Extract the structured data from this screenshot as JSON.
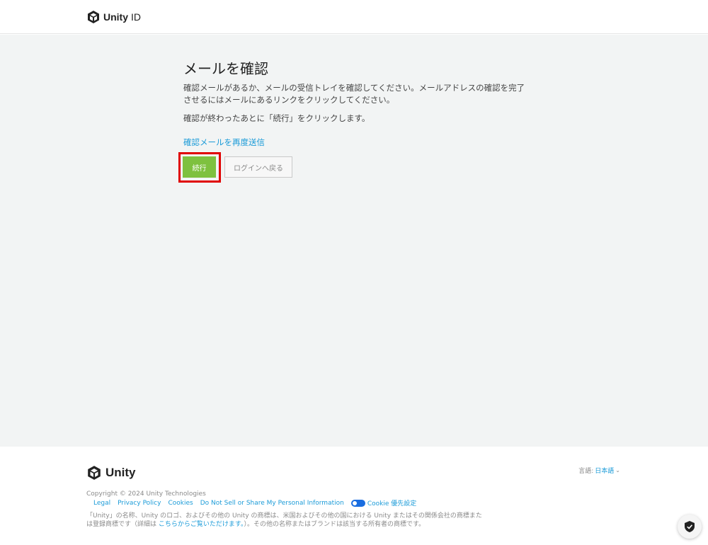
{
  "header": {
    "brand_bold": "Unity",
    "brand_light": "ID"
  },
  "main": {
    "title": "メールを確認",
    "paragraph1": "確認メールがあるか、メールの受信トレイを確認してください。メールアドレスの確認を完了させるにはメールにあるリンクをクリックしてください。",
    "paragraph2": "確認が終わったあとに「続行」をクリックします。",
    "resend_link": "確認メールを再度送信",
    "continue_button": "続行",
    "back_button": "ログインへ戻る"
  },
  "footer": {
    "logo_text": "Unity",
    "language_label": "言語:",
    "language_value": "日本語",
    "copyright": "Copyright © 2024 Unity Technologies",
    "links": [
      "Legal",
      "Privacy Policy",
      "Cookies",
      "Do Not Sell or Share My Personal Information"
    ],
    "cookie_pref": "Cookie 優先設定",
    "legal_part1": "「Unity」の名称、Unity のロゴ、およびその他の Unity の商標は、米国およびその他の国における Unity またはその関係会社の商標または登録商標です（詳細は ",
    "legal_link": "こちらからご覧いただけます。",
    "legal_part2": "）。その他の名称またはブランドは該当する所有者の商標です。"
  },
  "icons": {
    "brand": "unity-cube-icon",
    "shield": "shield-check-icon",
    "cookie": "toggle-check-icon",
    "chevron": "chevron-down-icon"
  },
  "colors": {
    "accent": "#1b9bd8",
    "continue": "#7ec13f",
    "highlight": "#e00000",
    "main_bg": "#f2f4f4"
  }
}
